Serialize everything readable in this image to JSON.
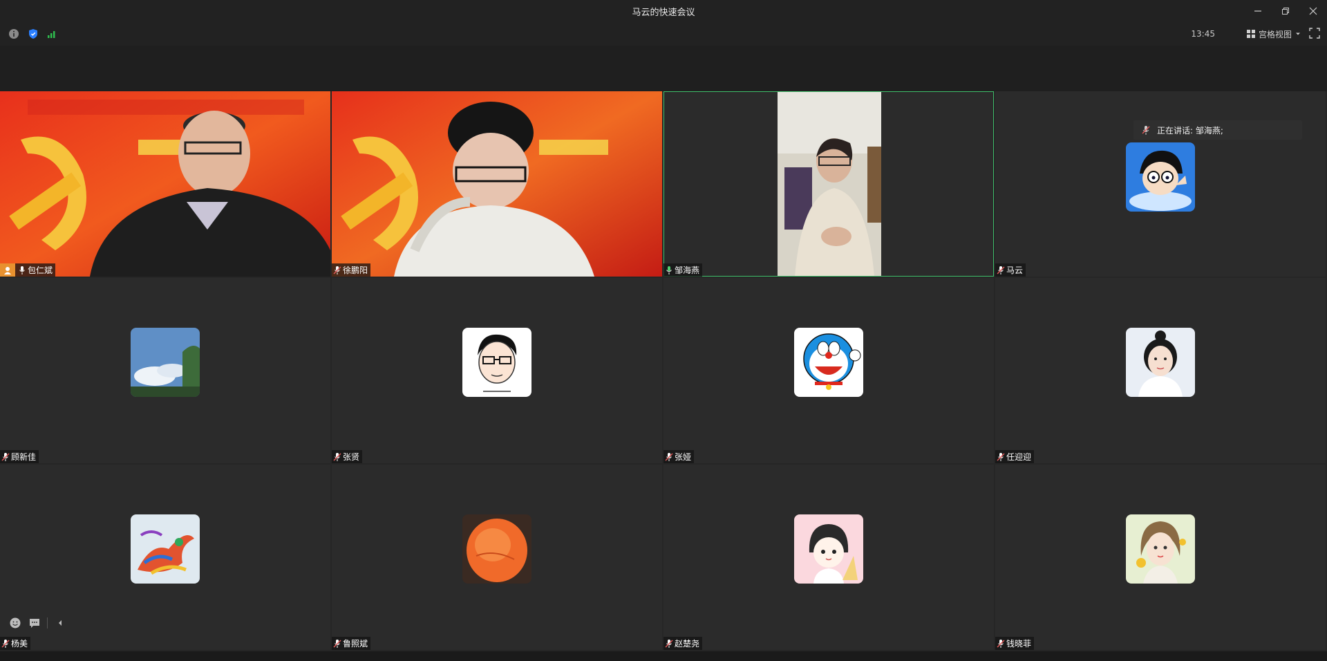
{
  "window": {
    "title": "马云的快速会议"
  },
  "toolbar": {
    "time": "13:45",
    "view_mode_label": "宫格视图"
  },
  "speaking": {
    "label": "正在讲话: 邹海燕;"
  },
  "participants": [
    {
      "name": "包仁斌",
      "is_host": true,
      "video": "banner-hammer-sickle-man"
    },
    {
      "name": "徐鹏阳",
      "is_host": false,
      "video": "banner-hammer-sickle-youth"
    },
    {
      "name": "邹海燕",
      "is_host": false,
      "video": "room-woman",
      "speaking": true
    },
    {
      "name": "马云",
      "is_host": false,
      "avatar": "cartoon-boy-glasses"
    },
    {
      "name": "顾新佳",
      "avatar": "sky-trees"
    },
    {
      "name": "张贤",
      "avatar": "cartoon-man-glasses"
    },
    {
      "name": "张娅",
      "avatar": "blue-robot-cat"
    },
    {
      "name": "任迎迎",
      "avatar": "girl-portrait"
    },
    {
      "name": "杨美",
      "avatar": "colorful-phoenix"
    },
    {
      "name": "鲁照斌",
      "avatar": "orange-stone"
    },
    {
      "name": "赵楚尧",
      "avatar": "cartoon-girl-pink"
    },
    {
      "name": "钱晓菲",
      "avatar": "illustrated-girl-green"
    }
  ],
  "colors": {
    "speaking_border": "#3fbf6a",
    "host_badge": "#e8912f",
    "muted_mic": "#e05a5a",
    "active_mic": "#4fcf6f",
    "secure_badge": "#2a7fff",
    "signal": "#2fbf4f"
  }
}
